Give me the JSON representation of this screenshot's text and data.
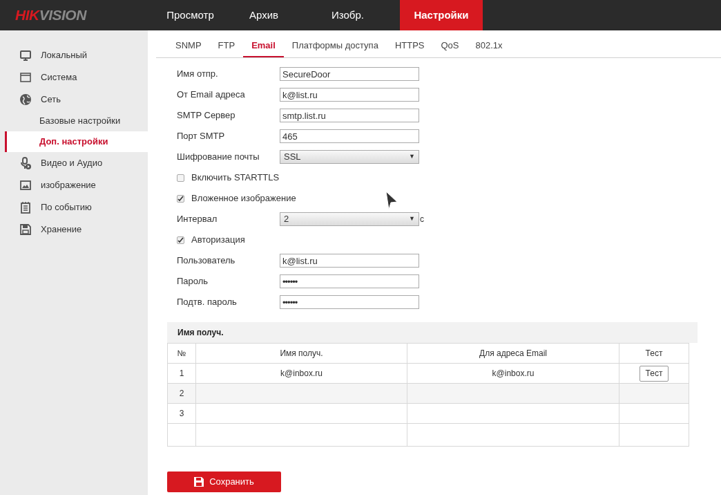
{
  "logo": {
    "part_1": "HIK",
    "part_2": "VISION"
  },
  "nav": [
    {
      "label": "Просмотр",
      "selected": false
    },
    {
      "label": "Архив",
      "selected": false
    },
    {
      "label": "Изобр.",
      "selected": false
    },
    {
      "label": "Настройки",
      "selected": true
    }
  ],
  "sidebar": {
    "items": [
      {
        "label": "Локальный",
        "kind": "monitor",
        "selected": false
      },
      {
        "label": "Система",
        "kind": "window",
        "selected": false
      },
      {
        "label": "Сеть",
        "kind": "globe",
        "selected": false,
        "children": [
          {
            "label": "Базовые настройки",
            "selected": false
          },
          {
            "label": "Доп. настройки",
            "selected": true
          }
        ]
      },
      {
        "label": "Видео и Аудио",
        "kind": "mic",
        "selected": false
      },
      {
        "label": "изображение",
        "kind": "image",
        "selected": false
      },
      {
        "label": "По событию",
        "kind": "list",
        "selected": false
      },
      {
        "label": "Хранение",
        "kind": "disk",
        "selected": false
      }
    ]
  },
  "tabs": [
    {
      "label": "SNMP",
      "selected": false
    },
    {
      "label": "FTP",
      "selected": false
    },
    {
      "label": "Email",
      "selected": true
    },
    {
      "label": "Платформы доступа",
      "selected": false
    },
    {
      "label": "HTTPS",
      "selected": false
    },
    {
      "label": "QoS",
      "selected": false
    },
    {
      "label": "802.1x",
      "selected": false
    }
  ],
  "form": [
    {
      "kind": "text",
      "label": "Имя отпр.",
      "value": "SecureDoor"
    },
    {
      "kind": "text",
      "label": "От Email адреса",
      "value": "k@list.ru"
    },
    {
      "kind": "text",
      "label": "SMTP Сервер",
      "value": "smtp.list.ru"
    },
    {
      "kind": "text",
      "label": "Порт SMTP",
      "value": "465"
    },
    {
      "kind": "select",
      "label": "Шифрование почты",
      "value": "SSL",
      "arrow": "▼"
    },
    {
      "kind": "checkbox",
      "label": "Включить STARTTLS",
      "checked": false
    },
    {
      "kind": "checkbox",
      "label": "Вложенное изображение",
      "checked": true
    },
    {
      "kind": "select",
      "label": "Интервал",
      "value": "2",
      "arrow": "▼",
      "unit": "с"
    },
    {
      "kind": "checkbox",
      "label": "Авторизация",
      "checked": true
    },
    {
      "kind": "text",
      "label": "Пользователь",
      "value": "k@list.ru"
    },
    {
      "kind": "password",
      "label": "Пароль",
      "value": "••••••"
    },
    {
      "kind": "password",
      "label": "Подтв. пароль",
      "value": "••••••"
    }
  ],
  "recipients": {
    "title": "Имя получ.",
    "columns": [
      "№",
      "Имя получ.",
      "Для адреса Email",
      "Тест"
    ],
    "rows": [
      {
        "no": "1",
        "name": "k@inbox.ru",
        "email": "k@inbox.ru",
        "test": "Тест"
      },
      {
        "no": "2"
      },
      {
        "no": "3"
      },
      {}
    ]
  },
  "save_button": "Сохранить"
}
